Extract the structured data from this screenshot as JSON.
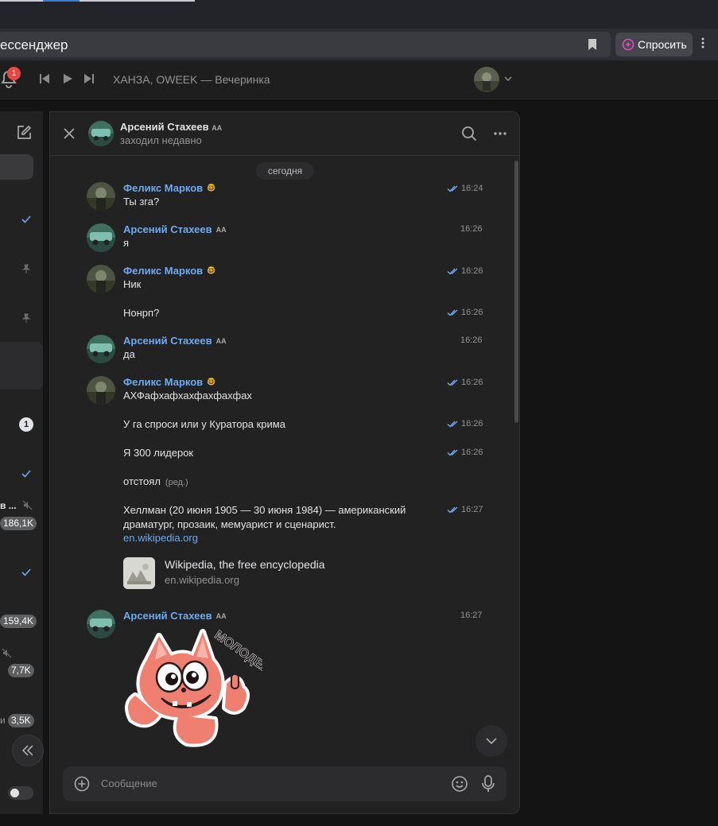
{
  "browser": {
    "address_text": "ессенджер",
    "ask_button_label": "Спросить",
    "icons": [
      "bookmark-icon",
      "sparkle-icon",
      "more-vertical-icon"
    ]
  },
  "topbar": {
    "notification_count": "1",
    "track_title": "ХАНЗА, OWEEK — Вечеринка",
    "icons": [
      "bell-icon",
      "previous-icon",
      "play-icon",
      "next-icon",
      "chevron-down-icon"
    ]
  },
  "sidebar": {
    "unread_count": "1",
    "fragments": [
      "в ...",
      "и"
    ],
    "counts": [
      "186,1K",
      "159,4K",
      "7,7K",
      "3,5K"
    ]
  },
  "chat": {
    "header": {
      "name": "Арсений Стахеев",
      "name_badge": "AA",
      "status": "заходил недавно"
    },
    "date_separator": "сегодня",
    "messages": [
      {
        "author": "Феликс Марков",
        "badge": "🤓",
        "text": "Ты зга?",
        "time": "16:24",
        "read": true
      },
      {
        "author": "Арсений Стахеев",
        "badge": "AA",
        "text": "я",
        "time": "16:26",
        "read": false
      },
      {
        "author": "Феликс Марков",
        "badge": "🤓",
        "text": "Ник",
        "time": "16:26",
        "read": true
      },
      {
        "author": "",
        "badge": "",
        "text": "Нонрп?",
        "time": "16:26",
        "read": true
      },
      {
        "author": "Арсений Стахеев",
        "badge": "AA",
        "text": "да",
        "time": "16:26",
        "read": false
      },
      {
        "author": "Феликс Марков",
        "badge": "🤓",
        "text": "АХФафхафхахфахфахфах",
        "time": "16:26",
        "read": true
      },
      {
        "author": "",
        "badge": "",
        "text": "У га спроси или у Куратора крима",
        "time": "16:26",
        "read": true
      },
      {
        "author": "",
        "badge": "",
        "text": "Я 300 лидерок",
        "time": "16:26",
        "read": true
      },
      {
        "author": "",
        "badge": "",
        "text": "отстоял",
        "edited": "(ред.)",
        "time": "",
        "read": false
      },
      {
        "author": "",
        "badge": "",
        "text": "Хеллман (20 июня 1905 — 30 июня 1984) — американский драматург, прозаик, мемуарист и сценарист.",
        "link": "en.wikipedia.org",
        "time": "16:27",
        "read": true
      },
      {
        "author": "Арсений Стахеев",
        "badge": "AA",
        "text": "",
        "time": "16:27",
        "read": false,
        "sticker": "МОЛОДЕЦ"
      }
    ],
    "link_preview": {
      "title": "Wikipedia, the free encyclopedia",
      "domain": "en.wikipedia.org"
    },
    "composer": {
      "placeholder": "Сообщение"
    }
  },
  "colors": {
    "accent": "#71aaeb",
    "background": "#141414",
    "panel": "#222222",
    "badge_red": "#e64646"
  }
}
